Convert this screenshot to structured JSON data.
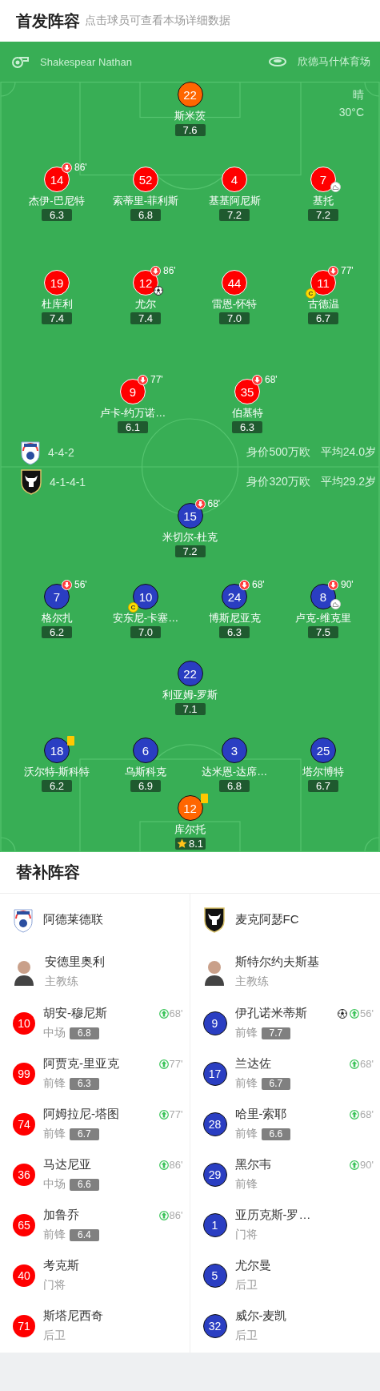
{
  "header": {
    "title": "首发阵容",
    "hint": "点击球员可查看本场详细数据"
  },
  "match_info": {
    "referee": "Shakespear Nathan",
    "stadium": "欣德马什体育场",
    "weather": "晴",
    "temperature": "30°C"
  },
  "home": {
    "formation": "4-4-2",
    "value": "身价500万欧",
    "age": "平均24.0岁",
    "lines": [
      [
        {
          "number": "22",
          "name": "斯米茨",
          "rating": "7.6",
          "color": "#ff6600",
          "goal": false,
          "assist": false,
          "yellow_card": false,
          "best": false
        }
      ],
      [
        {
          "number": "14",
          "name": "杰伊-巴尼特",
          "rating": "6.3",
          "color": "#ff0000",
          "sub_off": "86'",
          "goal": false,
          "assist": false,
          "yellow_card": false,
          "best": false
        },
        {
          "number": "52",
          "name": "索蒂里-菲利斯",
          "rating": "6.8",
          "color": "#ff0000",
          "goal": false,
          "assist": false,
          "yellow_card": false,
          "best": false
        },
        {
          "number": "4",
          "name": "基基阿尼斯",
          "rating": "7.2",
          "color": "#ff0000",
          "goal": false,
          "assist": false,
          "yellow_card": false,
          "best": false
        },
        {
          "number": "7",
          "name": "基托",
          "rating": "7.2",
          "color": "#ff0000",
          "goal": false,
          "assist": true,
          "yellow_card": false,
          "best": false
        }
      ],
      [
        {
          "number": "19",
          "name": "杜库利",
          "rating": "7.4",
          "color": "#ff0000",
          "goal": false,
          "assist": false,
          "yellow_card": false,
          "best": false
        },
        {
          "number": "12",
          "name": "尤尔",
          "rating": "7.4",
          "color": "#ff0000",
          "sub_off": "86'",
          "goal": true,
          "assist": false,
          "yellow_card": false,
          "best": false
        },
        {
          "number": "44",
          "name": "雷恩-怀特",
          "rating": "7.0",
          "color": "#ff0000",
          "goal": false,
          "assist": false,
          "yellow_card": false,
          "best": false
        },
        {
          "number": "11",
          "name": "古德温",
          "rating": "6.7",
          "color": "#ff0000",
          "sub_off": "77'",
          "captain": "C",
          "goal": false,
          "assist": false,
          "yellow_card": false,
          "best": false
        }
      ],
      [
        {
          "number": "9",
          "name": "卢卡-约万诺…",
          "rating": "6.1",
          "color": "#ff0000",
          "sub_off": "77'",
          "goal": false,
          "assist": false,
          "yellow_card": false,
          "best": false
        },
        {
          "number": "35",
          "name": "伯基特",
          "rating": "6.3",
          "color": "#ff0000",
          "sub_off": "68'",
          "goal": false,
          "assist": false,
          "yellow_card": false,
          "best": false
        }
      ]
    ]
  },
  "away": {
    "formation": "4-1-4-1",
    "value": "身价320万欧",
    "age": "平均29.2岁",
    "lines": [
      [
        {
          "number": "15",
          "name": "米切尔-杜克",
          "rating": "7.2",
          "color": "#2a3ec2",
          "sub_off": "68'",
          "goal": false,
          "assist": false,
          "yellow_card": false,
          "best": false
        }
      ],
      [
        {
          "number": "7",
          "name": "格尔扎",
          "rating": "6.2",
          "color": "#2a3ec2",
          "sub_off": "56'",
          "goal": false,
          "assist": false,
          "yellow_card": false,
          "best": false
        },
        {
          "number": "10",
          "name": "安东尼-卡塞…",
          "rating": "7.0",
          "color": "#2a3ec2",
          "captain": "C",
          "goal": false,
          "assist": false,
          "yellow_card": false,
          "best": false
        },
        {
          "number": "24",
          "name": "博斯尼亚克",
          "rating": "6.3",
          "color": "#2a3ec2",
          "sub_off": "68'",
          "goal": false,
          "assist": false,
          "yellow_card": false,
          "best": false
        },
        {
          "number": "8",
          "name": "卢克-维克里",
          "rating": "7.5",
          "color": "#2a3ec2",
          "sub_off": "90'",
          "goal": false,
          "assist": true,
          "yellow_card": false,
          "best": false
        }
      ],
      [
        {
          "number": "22",
          "name": "利亚姆-罗斯",
          "rating": "7.1",
          "color": "#2a3ec2",
          "goal": false,
          "assist": false,
          "yellow_card": false,
          "best": false
        }
      ],
      [
        {
          "number": "18",
          "name": "沃尔特-斯科特",
          "rating": "6.2",
          "color": "#2a3ec2",
          "goal": false,
          "assist": false,
          "yellow_card": true,
          "best": false
        },
        {
          "number": "6",
          "name": "乌斯科克",
          "rating": "6.9",
          "color": "#2a3ec2",
          "goal": false,
          "assist": false,
          "yellow_card": false,
          "best": false
        },
        {
          "number": "3",
          "name": "达米恩-达席…",
          "rating": "6.8",
          "color": "#2a3ec2",
          "goal": false,
          "assist": false,
          "yellow_card": false,
          "best": false
        },
        {
          "number": "25",
          "name": "塔尔博特",
          "rating": "6.7",
          "color": "#2a3ec2",
          "goal": false,
          "assist": false,
          "yellow_card": false,
          "best": false
        }
      ],
      [
        {
          "number": "12",
          "name": "库尔托",
          "rating": "8.1",
          "color": "#ff6600",
          "goal": false,
          "assist": false,
          "yellow_card": true,
          "best": true
        }
      ]
    ]
  },
  "subs_title": "替补阵容",
  "bench": [
    {
      "team": "阿德莱德联",
      "coach": "安德里奥利",
      "coach_role": "主教练",
      "color": "#ff0000",
      "subs": [
        {
          "number": "10",
          "name": "胡安-穆尼斯",
          "position": "中场",
          "rating": "6.8",
          "sub_in": "68'",
          "goal": false
        },
        {
          "number": "99",
          "name": "阿贾克-里亚克",
          "position": "前锋",
          "rating": "6.3",
          "sub_in": "77'",
          "goal": false
        },
        {
          "number": "74",
          "name": "阿姆拉尼-塔图",
          "position": "前锋",
          "rating": "6.7",
          "sub_in": "77'",
          "goal": false
        },
        {
          "number": "36",
          "name": "马达尼亚",
          "position": "中场",
          "rating": "6.6",
          "sub_in": "86'",
          "goal": false
        },
        {
          "number": "65",
          "name": "加鲁乔",
          "position": "前锋",
          "rating": "6.4",
          "sub_in": "86'",
          "goal": false
        },
        {
          "number": "40",
          "name": "考克斯",
          "position": "门将",
          "goal": false
        },
        {
          "number": "71",
          "name": "斯塔尼西奇",
          "position": "后卫",
          "goal": false
        }
      ]
    },
    {
      "team": "麦克阿瑟FC",
      "coach": "斯特尔约夫斯基",
      "coach_role": "主教练",
      "color": "#2a3ec2",
      "subs": [
        {
          "number": "9",
          "name": "伊孔诺米蒂斯",
          "position": "前锋",
          "rating": "7.7",
          "sub_in": "56'",
          "goal": true
        },
        {
          "number": "17",
          "name": "兰达佐",
          "position": "前锋",
          "rating": "6.7",
          "sub_in": "68'",
          "goal": false
        },
        {
          "number": "28",
          "name": "哈里-索耶",
          "position": "前锋",
          "rating": "6.6",
          "sub_in": "68'",
          "goal": false
        },
        {
          "number": "29",
          "name": "黑尔韦",
          "position": "前锋",
          "sub_in": "90'",
          "goal": false
        },
        {
          "number": "1",
          "name": "亚历克斯-罗…",
          "position": "门将",
          "goal": false
        },
        {
          "number": "5",
          "name": "尤尔曼",
          "position": "后卫",
          "goal": false
        },
        {
          "number": "32",
          "name": "威尔-麦凯",
          "position": "后卫",
          "goal": false
        }
      ]
    }
  ]
}
